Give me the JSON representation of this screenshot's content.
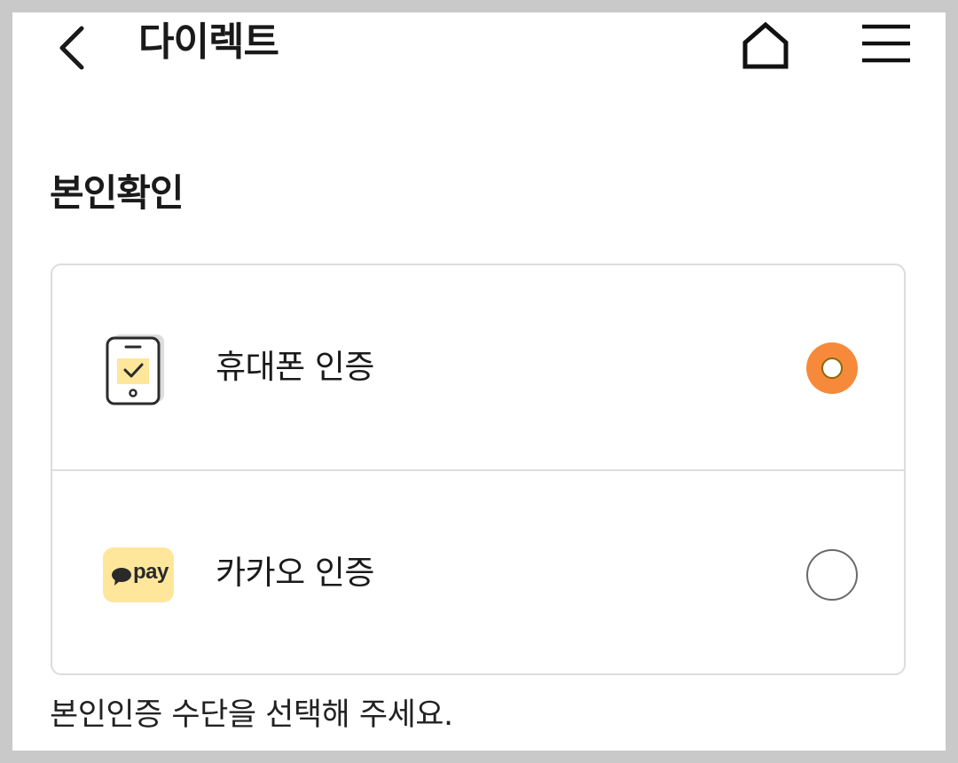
{
  "header": {
    "title": "다이렉트",
    "back_icon": "chevron-left-icon",
    "home_icon": "home-icon",
    "menu_icon": "hamburger-menu-icon"
  },
  "section": {
    "title": "본인확인"
  },
  "options": [
    {
      "label": "휴대폰 인증",
      "icon": "phone-check-icon",
      "selected": true
    },
    {
      "label": "카카오 인증",
      "icon": "kakao-pay-icon",
      "badge_text": "pay",
      "selected": false
    }
  ],
  "helper_text": "본인인증 수단을 선택해 주세요.",
  "colors": {
    "accent": "#f7893b",
    "badge_yellow": "#fee79b",
    "border": "#dcdcdc"
  }
}
